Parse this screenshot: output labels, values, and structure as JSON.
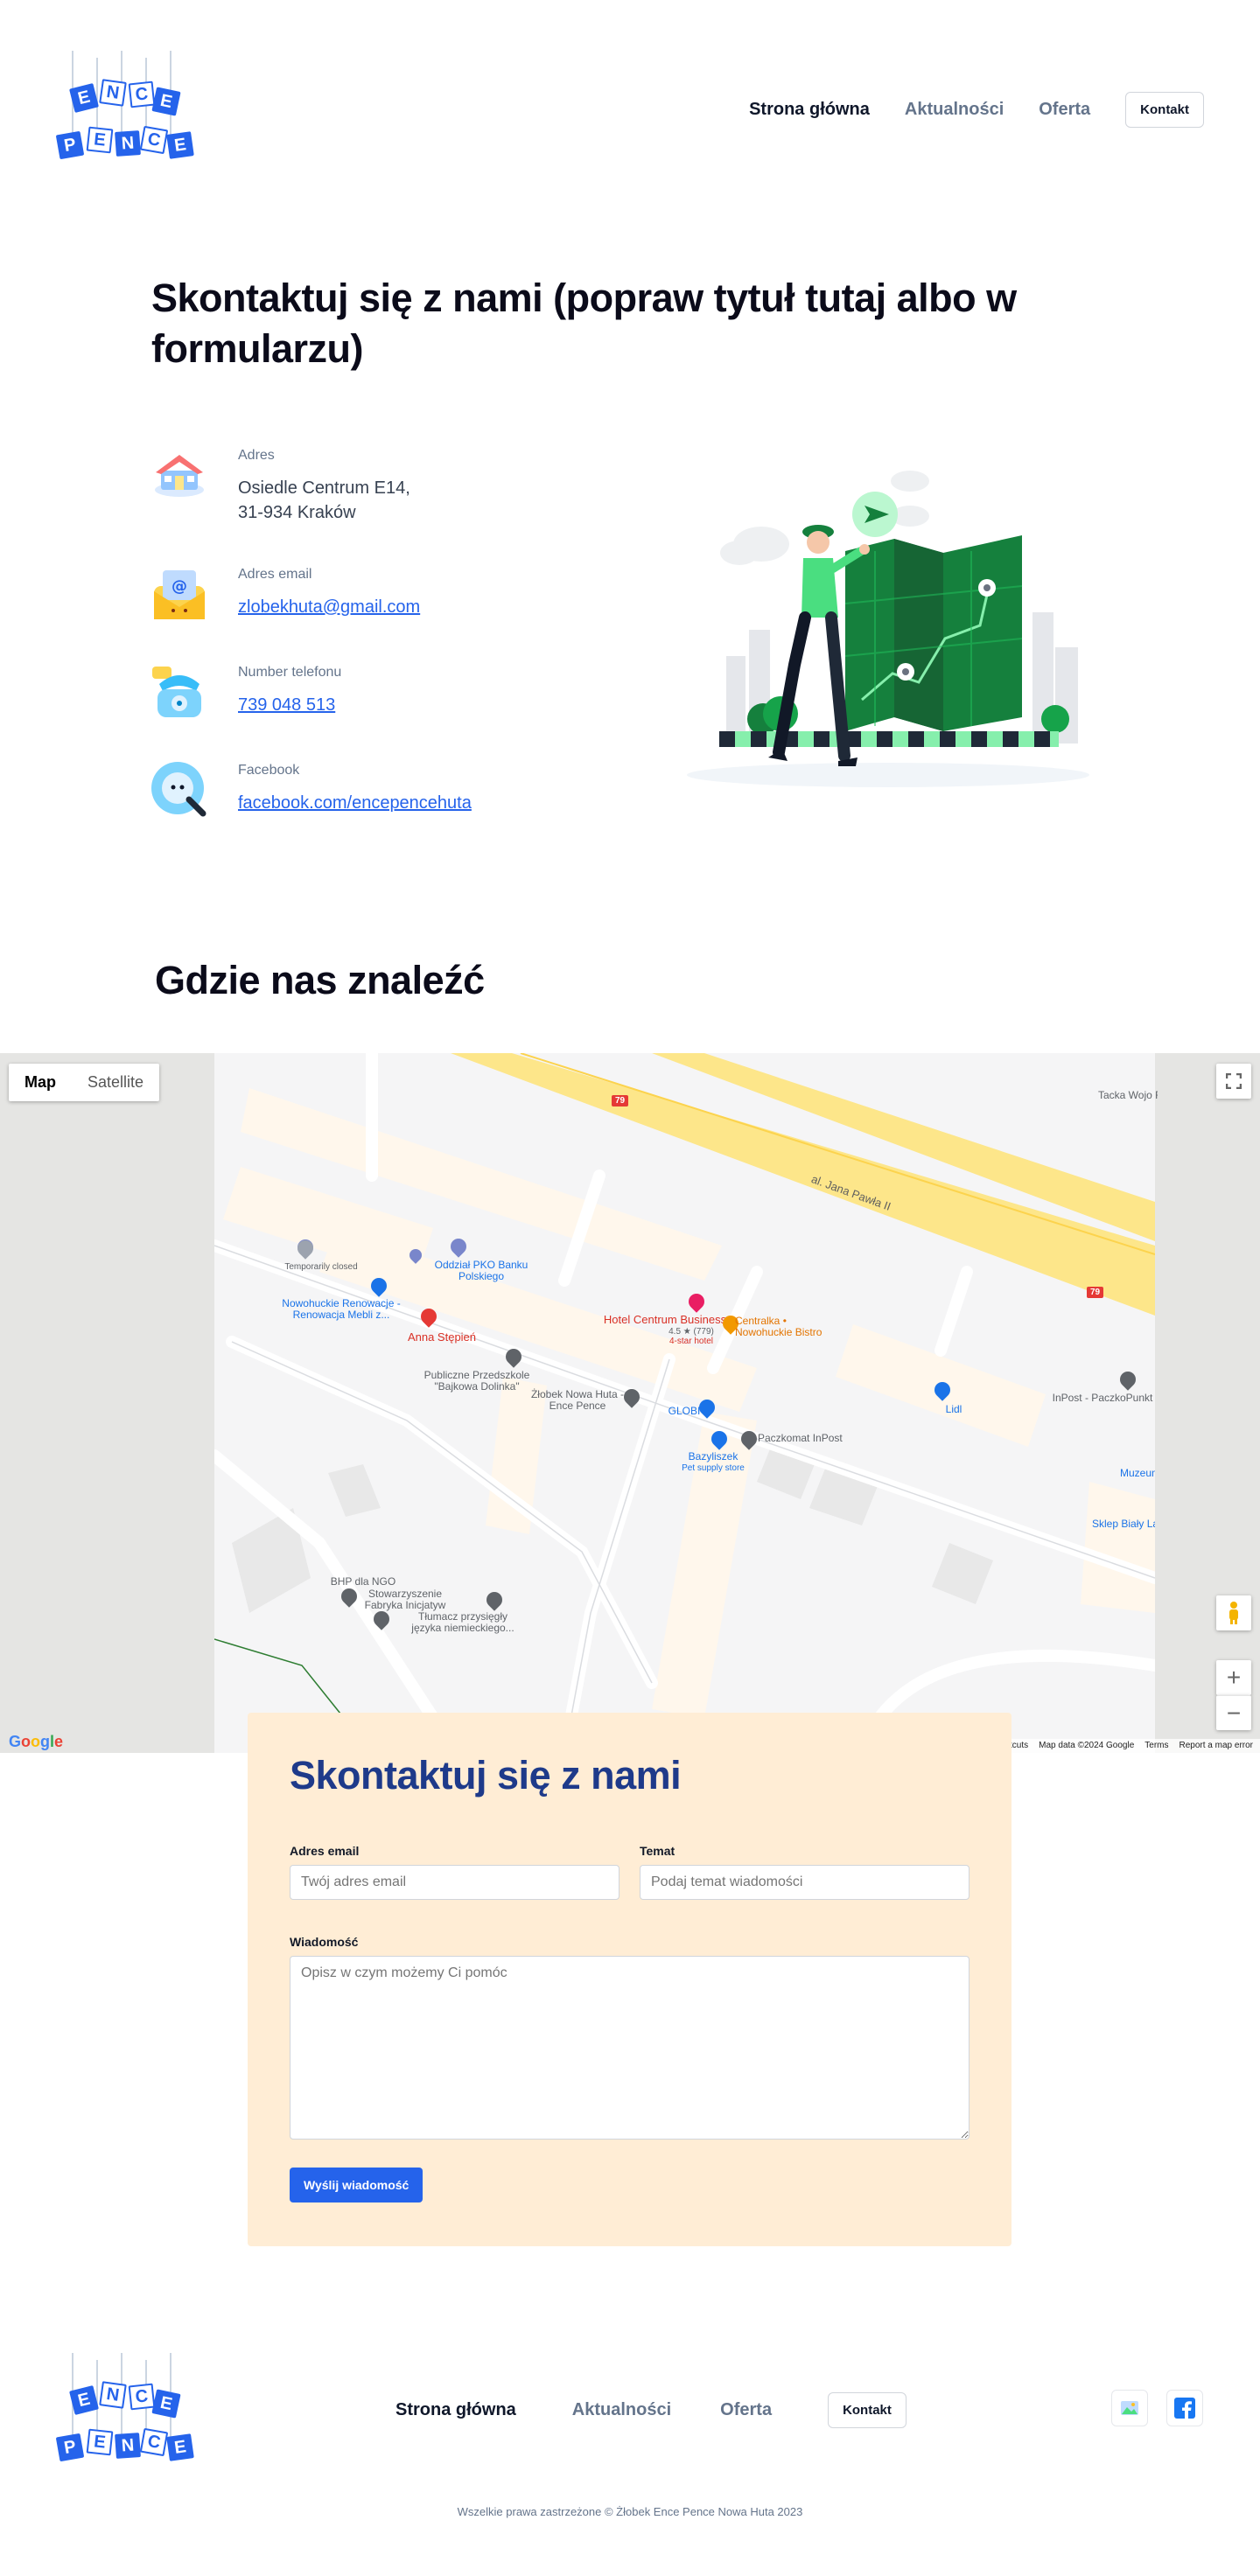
{
  "logo": {
    "letters_top": [
      "E",
      "N",
      "C",
      "E"
    ],
    "letters_bottom": [
      "P",
      "E",
      "N",
      "C",
      "E"
    ]
  },
  "nav": {
    "items": [
      {
        "label": "Strona główna",
        "active": true
      },
      {
        "label": "Aktualności",
        "active": false
      },
      {
        "label": "Oferta",
        "active": false
      }
    ],
    "contact_label": "Kontakt"
  },
  "page_title": "Skontaktuj się z nami (popraw tytuł tutaj albo w formularzu)",
  "contact": {
    "address": {
      "label": "Adres",
      "line1": "Osiedle Centrum E14,",
      "line2": "31-934 Kraków",
      "icon": "house-icon"
    },
    "email": {
      "label": "Adres email",
      "value": "zlobekhuta@gmail.com",
      "icon": "mail-icon"
    },
    "phone": {
      "label": "Number telefonu",
      "value": "739 048 513",
      "icon": "phone-icon"
    },
    "facebook": {
      "label": "Facebook",
      "value": "facebook.com/encepencehuta",
      "icon": "facebook-search-icon"
    }
  },
  "where_title": "Gdzie nas znaleźć",
  "map": {
    "type_map": "Map",
    "type_satellite": "Satellite",
    "street": "al. Jana Pawła II",
    "route_badge": "79",
    "pois": {
      "temp_closed": "Temporarily closed",
      "pko": "Oddział PKO Banku Polskiego",
      "nowohuckie": "Nowohuckie Renowacje - Renowacja Mebli z...",
      "anna": "Anna Stępień",
      "hotel": "Hotel Centrum Business",
      "hotel_rating": "4.5 ★ (779)",
      "hotel_type": "4-star hotel",
      "centralka": "Centralka • Nowohuckie Bistro",
      "przedszkole": "Publiczne Przedszkole \"Bajkowa Dolinka\"",
      "zlobek": "Żłobek Nowa Huta - Ence Pence",
      "globi": "GLOBI",
      "paczkomat": "Paczkomat InPost",
      "lidl": "Lidl",
      "inpost": "InPost - PaczkoPunkt",
      "bazyliszek": "Bazyliszek",
      "bazyliszek_type": "Pet supply store",
      "tacka": "Tacka Wojo Renowacja c",
      "muzeum": "Muzeum",
      "sklep": "Sklep Biały La",
      "bhp": "BHP dla NGO",
      "stowarzyszenie": "Stowarzyszenie Fabryka Inicjatyw",
      "tlumacz": "Tłumacz przysięgły języka niemieckiego..."
    },
    "footer": {
      "shortcuts": "shortcuts",
      "data": "Map data ©2024 Google",
      "terms": "Terms",
      "report": "Report a map error"
    },
    "google": "Google",
    "zoom_in": "+",
    "zoom_out": "−"
  },
  "form": {
    "title": "Skontaktuj się z nami",
    "email_label": "Adres email",
    "email_placeholder": "Twój adres email",
    "subject_label": "Temat",
    "subject_placeholder": "Podaj temat wiadomości",
    "message_label": "Wiadomość",
    "message_placeholder": "Opisz w czym możemy Ci pomóc",
    "submit_label": "Wyślij wiadomość"
  },
  "footer": {
    "nav": [
      "Strona główna",
      "Aktualności",
      "Oferta"
    ],
    "contact_label": "Kontakt",
    "copyright": "Wszelkie prawa zastrzeżone © Żłobek Ence Pence Nowa Huta 2023"
  },
  "colors": {
    "brand_blue": "#2563eb",
    "form_bg": "#ffedd5",
    "form_title": "#1e3a8a",
    "illustration_green": "#15803d"
  }
}
